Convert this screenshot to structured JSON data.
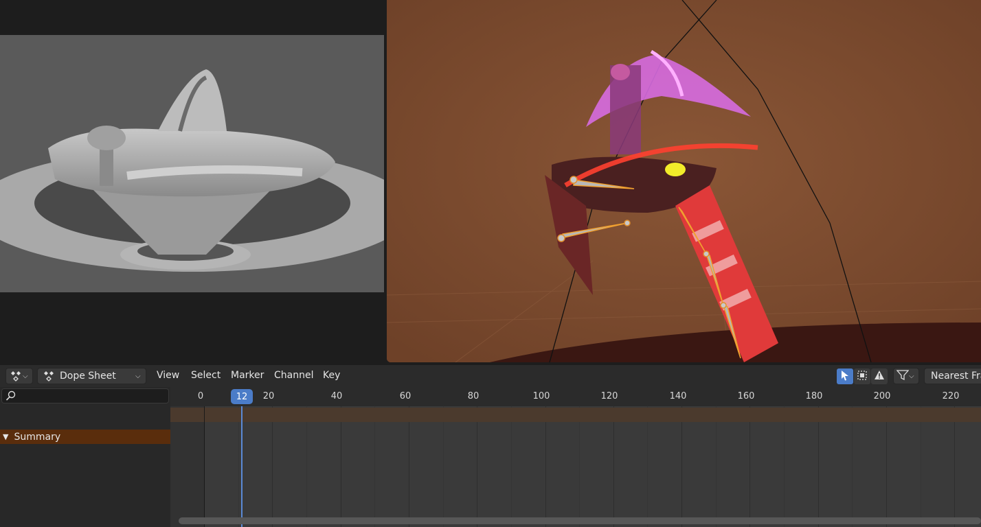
{
  "header": {
    "editor_type_icon": "dope-sheet-icon",
    "mode_label": "Dope Sheet",
    "menus": [
      "View",
      "Select",
      "Marker",
      "Channel",
      "Key"
    ],
    "snapping_label": "Nearest Fra",
    "tools": {
      "select_icon": "cursor-arrow-icon",
      "box_icon": "box-select-icon",
      "warning_icon": "warning-icon",
      "filter_icon": "filter-funnel-icon"
    }
  },
  "channels": {
    "search_placeholder": "",
    "summary_label": "Summary"
  },
  "timeline": {
    "ticks": [
      "0",
      "20",
      "40",
      "60",
      "80",
      "100",
      "120",
      "140",
      "160",
      "180",
      "200",
      "220"
    ],
    "current_frame": "12",
    "current_frame_value": 12
  },
  "colors": {
    "accent": "#4b7cc8",
    "summary_row": "#5a2d0c",
    "viewport_bg": "#7a4a30"
  }
}
